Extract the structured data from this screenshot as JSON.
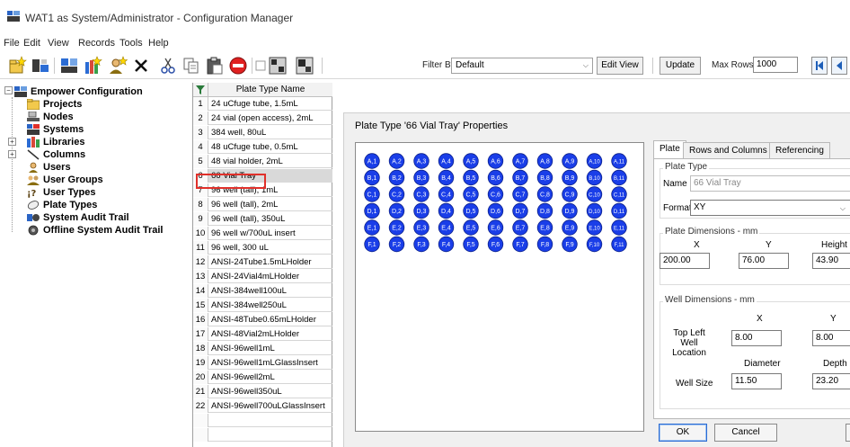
{
  "window": {
    "title": "WAT1 as System/Administrator - Configuration Manager"
  },
  "menu": [
    "File",
    "Edit",
    "View",
    "Records",
    "Tools",
    "Help"
  ],
  "toolbar": {
    "filter_label": "Filter By:",
    "filter_value": "Default",
    "edit_view": "Edit View",
    "update": "Update",
    "max_rows_label": "Max Rows",
    "max_rows_value": "1000"
  },
  "tree": {
    "root": "Empower Configuration",
    "items": [
      "Projects",
      "Nodes",
      "Systems",
      "Libraries",
      "Columns",
      "Users",
      "User Groups",
      "User Types",
      "Plate Types",
      "System Audit Trail",
      "Offline System Audit Trail"
    ]
  },
  "grid": {
    "header": "Plate Type Name",
    "rows": [
      {
        "num": "1",
        "name": "24 uCfuge tube, 1.5mL"
      },
      {
        "num": "2",
        "name": "24 vial (open access), 2mL"
      },
      {
        "num": "3",
        "name": "384 well, 80uL"
      },
      {
        "num": "4",
        "name": "48 uCfuge tube, 0.5mL"
      },
      {
        "num": "5",
        "name": "48 vial holder, 2mL"
      },
      {
        "num": "6",
        "name": "66 Vial Tray"
      },
      {
        "num": "7",
        "name": "96 well (tall), 1mL"
      },
      {
        "num": "8",
        "name": "96 well (tall), 2mL"
      },
      {
        "num": "9",
        "name": "96 well (tall), 350uL"
      },
      {
        "num": "10",
        "name": "96 well w/700uL insert"
      },
      {
        "num": "11",
        "name": "96 well, 300 uL"
      },
      {
        "num": "12",
        "name": "ANSI-24Tube1.5mLHolder"
      },
      {
        "num": "13",
        "name": "ANSI-24Vial4mLHolder"
      },
      {
        "num": "14",
        "name": "ANSI-384well100uL"
      },
      {
        "num": "15",
        "name": "ANSI-384well250uL"
      },
      {
        "num": "16",
        "name": "ANSI-48Tube0.65mLHolder"
      },
      {
        "num": "17",
        "name": "ANSI-48Vial2mLHolder"
      },
      {
        "num": "18",
        "name": "ANSI-96well1mL"
      },
      {
        "num": "19",
        "name": "ANSI-96well1mLGlassInsert"
      },
      {
        "num": "20",
        "name": "ANSI-96well2mL"
      },
      {
        "num": "21",
        "name": "ANSI-96well350uL"
      },
      {
        "num": "22",
        "name": "ANSI-96well700uLGlassInsert"
      }
    ],
    "selected_row": 5
  },
  "properties": {
    "title": "Plate Type '66 Vial Tray' Properties",
    "tabs": [
      "Plate",
      "Rows and Columns",
      "Referencing"
    ],
    "active_tab": 0,
    "wells": {
      "rows": [
        "A",
        "B",
        "C",
        "D",
        "E",
        "F"
      ],
      "columns": 11,
      "color": "#1a3ee8",
      "label_sep": ","
    },
    "plate_type_group": "Plate Type",
    "name_label": "Name",
    "name_value": "66 Vial Tray",
    "format_label": "Format",
    "format_value": "XY",
    "plate_dims_group": "Plate Dimensions - mm",
    "plate_dims_headers": [
      "X",
      "Y",
      "Height"
    ],
    "plate_dims_values": [
      "200.00",
      "76.00",
      "43.90"
    ],
    "well_dims_group": "Well Dimensions - mm",
    "top_left_label": "Top Left Well Location",
    "top_left_label_line1": "Top Left",
    "top_left_label_line2": "Well Location",
    "top_left_headers": [
      "X",
      "Y"
    ],
    "top_left_values": [
      "8.00",
      "8.00"
    ],
    "well_size_label": "Well Size",
    "well_size_headers": [
      "Diameter",
      "Depth"
    ],
    "well_size_values": [
      "11.50",
      "23.20"
    ],
    "ok": "OK",
    "cancel": "Cancel"
  }
}
